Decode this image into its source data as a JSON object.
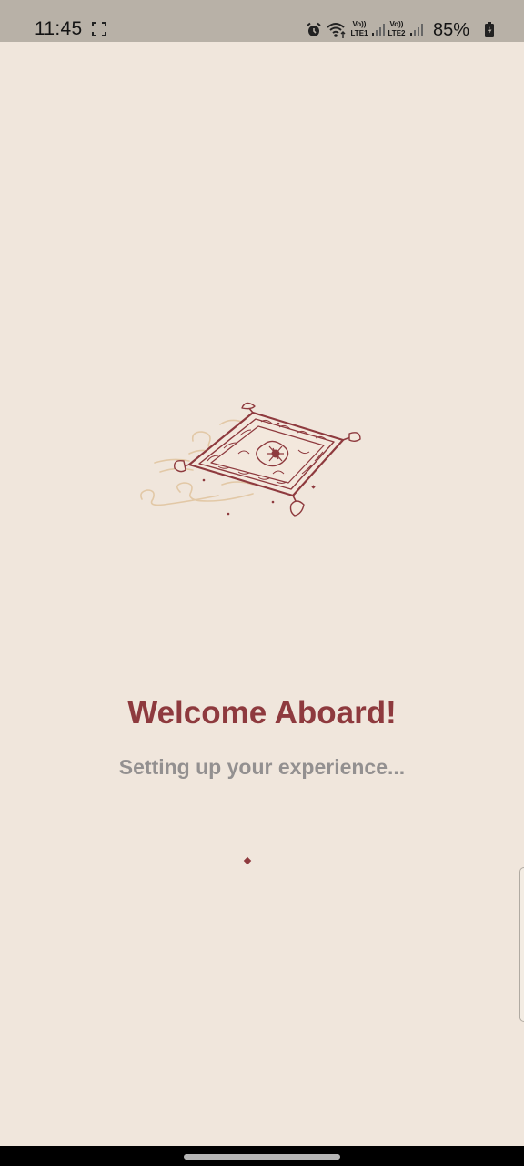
{
  "status_bar": {
    "time": "11:45",
    "battery_percent": "85%",
    "sim1_label_top": "Vo))",
    "sim1_label_bottom": "LTE1",
    "sim2_label_top": "Vo))",
    "sim2_label_bottom": "LTE2",
    "icons": [
      "screenshot-icon",
      "alarm-icon",
      "wifi-icon",
      "signal-icon",
      "signal-icon",
      "battery-icon"
    ]
  },
  "main": {
    "illustration": "flying-carpet-icon",
    "title": "Welcome Aboard!",
    "subtitle": "Setting up your experience..."
  },
  "colors": {
    "background": "#f0e6dc",
    "accent": "#8e3a3e",
    "subtitle": "#939090",
    "swirl": "#e2c8a6"
  }
}
